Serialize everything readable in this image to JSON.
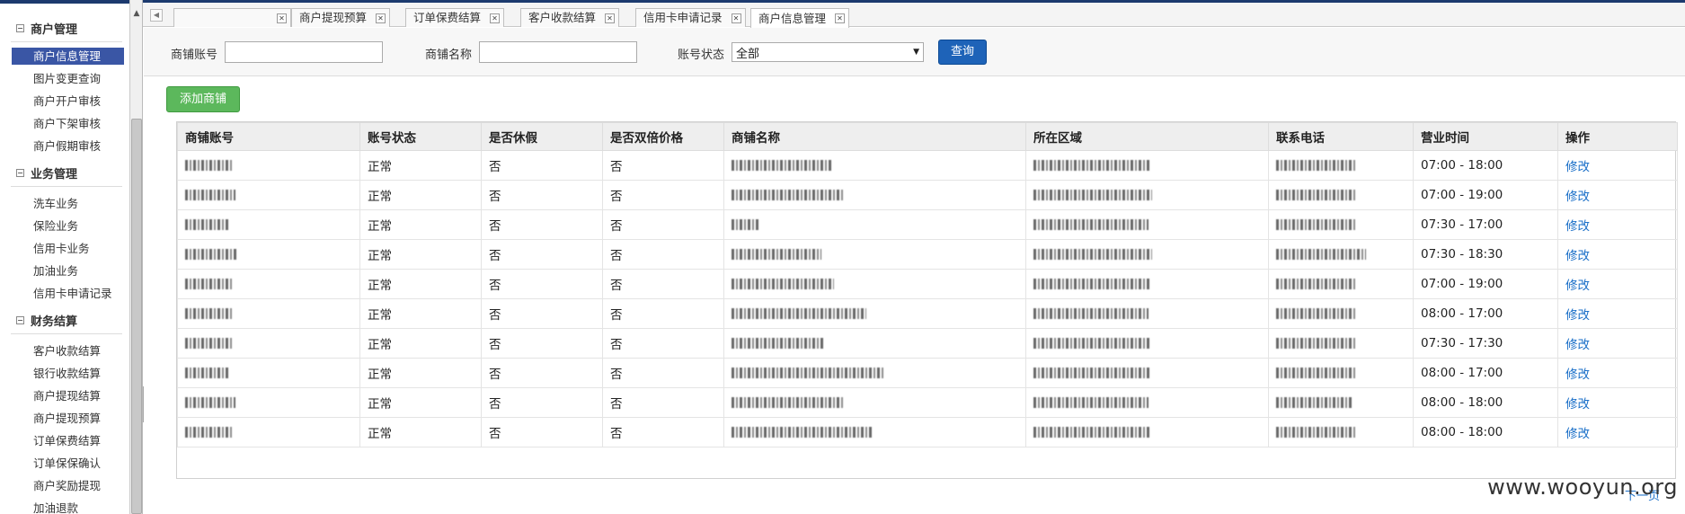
{
  "sidebar": {
    "groups": [
      {
        "title": "商户管理",
        "items": [
          "商户信息管理",
          "图片变更查询",
          "商户开户审核",
          "商户下架审核",
          "商户假期审核"
        ]
      },
      {
        "title": "业务管理",
        "items": [
          "洗车业务",
          "保险业务",
          "信用卡业务",
          "加油业务",
          "信用卡申请记录"
        ]
      },
      {
        "title": "财务结算",
        "items": [
          "客户收款结算",
          "银行收款结算",
          "商户提现结算",
          "商户提现预算",
          "订单保费结算",
          "订单保保确认",
          "商户奖励提现",
          "加油退款"
        ]
      }
    ],
    "active_item": "商户信息管理"
  },
  "tabs": [
    "",
    "商户提现预算",
    "订单保费结算",
    "客户收款结算",
    "信用卡申请记录",
    "商户信息管理"
  ],
  "search": {
    "account_label": "商铺账号",
    "account_value": "",
    "name_label": "商铺名称",
    "name_value": "",
    "status_label": "账号状态",
    "status_value": "全部",
    "query_button": "查询"
  },
  "add_button": "添加商铺",
  "table": {
    "columns": [
      "商铺账号",
      "账号状态",
      "是否休假",
      "是否双倍价格",
      "商铺名称",
      "所在区域",
      "联系电话",
      "营业时间",
      "操作"
    ],
    "rows": [
      {
        "status": "正常",
        "vacation": "否",
        "double": "否",
        "hours": "07:00 - 18:00",
        "action": "修改"
      },
      {
        "status": "正常",
        "vacation": "否",
        "double": "否",
        "hours": "07:00 - 19:00",
        "action": "修改"
      },
      {
        "status": "正常",
        "vacation": "否",
        "double": "否",
        "hours": "07:30 - 17:00",
        "action": "修改"
      },
      {
        "status": "正常",
        "vacation": "否",
        "double": "否",
        "hours": "07:30 - 18:30",
        "action": "修改"
      },
      {
        "status": "正常",
        "vacation": "否",
        "double": "否",
        "hours": "07:00 - 19:00",
        "action": "修改"
      },
      {
        "status": "正常",
        "vacation": "否",
        "double": "否",
        "hours": "08:00 - 17:00",
        "action": "修改"
      },
      {
        "status": "正常",
        "vacation": "否",
        "double": "否",
        "hours": "07:30 - 17:30",
        "action": "修改"
      },
      {
        "status": "正常",
        "vacation": "否",
        "double": "否",
        "hours": "08:00 - 17:00",
        "action": "修改"
      },
      {
        "status": "正常",
        "vacation": "否",
        "double": "否",
        "hours": "08:00 - 18:00",
        "action": "修改"
      },
      {
        "status": "正常",
        "vacation": "否",
        "double": "否",
        "hours": "08:00 - 18:00",
        "action": "修改"
      }
    ]
  },
  "pagination": {
    "next": "下一页"
  },
  "watermark": "www.wooyun.org",
  "colors": {
    "primary_button": "#1e63b8",
    "add_button": "#5cb85c",
    "active_nav": "#3a56a5",
    "link": "#1a6fc8"
  }
}
